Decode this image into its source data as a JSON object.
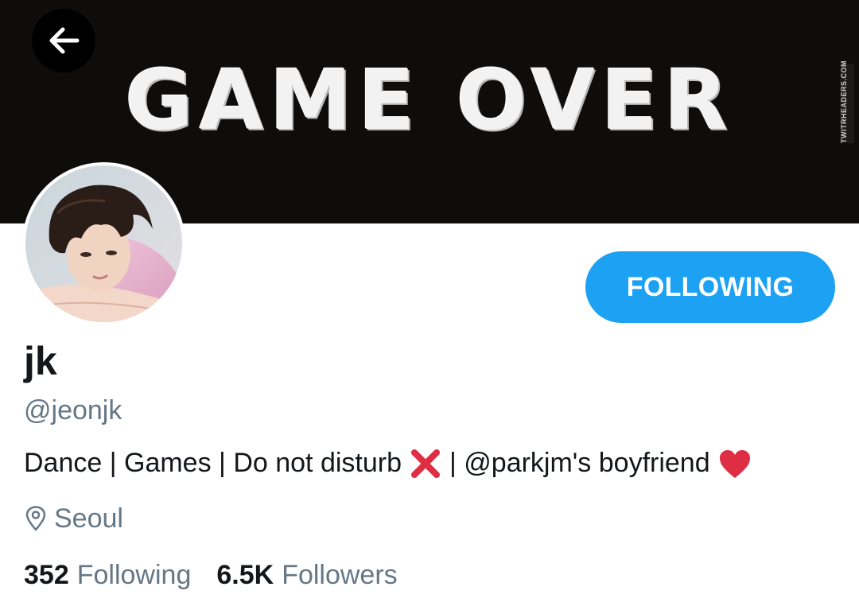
{
  "header": {
    "banner_text": "GAME OVER",
    "watermark": "TWITRHEADERS.COM",
    "back_icon": "arrow-left-icon"
  },
  "profile": {
    "display_name": "jk",
    "handle": "@jeonjk",
    "bio": {
      "part1": "Dance | Games | Do not disturb",
      "x_emoji": "❌",
      "part2": "| @parkjm's boyfriend",
      "heart_emoji": "❤"
    },
    "location": "Seoul",
    "location_icon": "map-pin-icon",
    "follow_button_label": "FOLLOWING"
  },
  "stats": {
    "following_count": "352",
    "following_label": "Following",
    "followers_count": "6.5K",
    "followers_label": "Followers"
  },
  "colors": {
    "accent": "#1da1f2",
    "banner_bg": "#0f0d0c",
    "secondary_text": "#657786",
    "primary_text": "#14171a",
    "emoji_red": "#dd2e44"
  }
}
